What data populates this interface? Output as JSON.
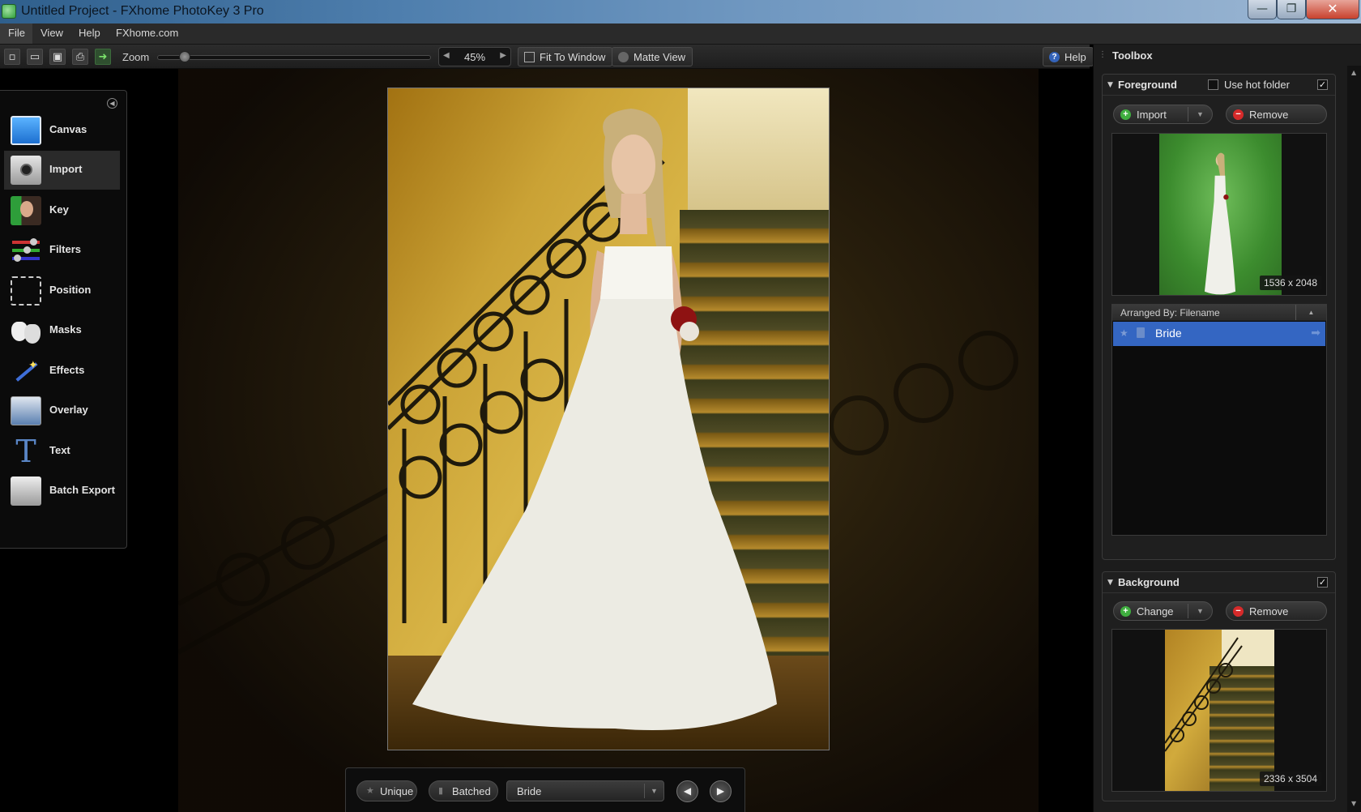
{
  "window": {
    "title": "Untitled Project - FXhome PhotoKey 3 Pro",
    "minimize": "—",
    "maximize": "❐",
    "close": "✕"
  },
  "menu": {
    "items": [
      "File",
      "View",
      "Help",
      "FXhome.com"
    ]
  },
  "toolbar": {
    "zoom_label": "Zoom",
    "zoom_value": "45%",
    "zoom_level": 0.1,
    "fit_label": "Fit To Window",
    "matte_label": "Matte View",
    "help_label": "Help",
    "icons": [
      "new-icon",
      "open-icon",
      "save-icon",
      "print-icon",
      "export-arrow-icon"
    ]
  },
  "tools": {
    "items": [
      {
        "label": "Canvas",
        "icon": "canvas-icon"
      },
      {
        "label": "Import",
        "icon": "camera-icon"
      },
      {
        "label": "Key",
        "icon": "key-person-icon"
      },
      {
        "label": "Filters",
        "icon": "sliders-icon"
      },
      {
        "label": "Position",
        "icon": "position-icon"
      },
      {
        "label": "Masks",
        "icon": "masks-icon"
      },
      {
        "label": "Effects",
        "icon": "magic-wand-icon"
      },
      {
        "label": "Overlay",
        "icon": "overlay-icon"
      },
      {
        "label": "Text",
        "icon": "text-icon"
      },
      {
        "label": "Batch Export",
        "icon": "batch-export-icon"
      }
    ],
    "active": "Import"
  },
  "bottombar": {
    "unique_label": "Unique",
    "batched_label": "Batched",
    "selected": "Bride"
  },
  "toolbox": {
    "title": "Toolbox",
    "foreground": {
      "title": "Foreground",
      "hot_folder_label": "Use hot folder",
      "hot_folder_checked": false,
      "enabled": "✓",
      "import_label": "Import",
      "remove_label": "Remove",
      "thumb_size": "1536 x 2048",
      "arranged_by": "Arranged By: Filename",
      "items": [
        "Bride"
      ]
    },
    "background": {
      "title": "Background",
      "enabled": "✓",
      "change_label": "Change",
      "remove_label": "Remove",
      "thumb_size": "2336 x 3504"
    }
  },
  "colors": {
    "accent_blue": "#3466c2",
    "add_green": "#3fae3f",
    "remove_red": "#d62a2a"
  }
}
